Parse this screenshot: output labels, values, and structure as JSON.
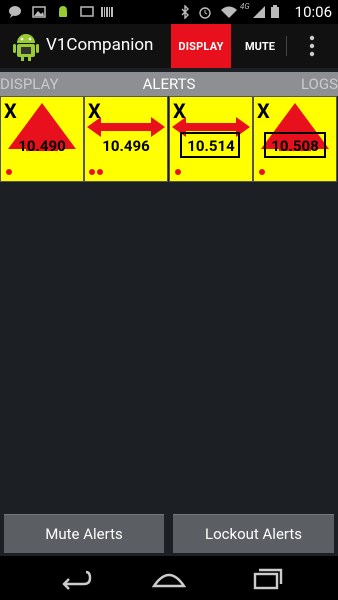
{
  "status_bar": {
    "time": "10:06",
    "icons": [
      "chat-bubble-icon",
      "image-icon",
      "android-icon",
      "cast-icon",
      "barcode-icon",
      "bluetooth-icon",
      "alarm-icon",
      "wifi-icon",
      "signal-icon",
      "battery-icon"
    ],
    "network_label": "4G"
  },
  "action_bar": {
    "title": "V1Companion",
    "display_label": "DISPLAY",
    "mute_label": "MUTE"
  },
  "tabs": {
    "left": "DISPLAY",
    "center": "ALERTS",
    "right": "LOGS"
  },
  "alerts": [
    {
      "band": "X",
      "frequency": "10.490",
      "arrow": "front",
      "signal_dots": 1,
      "boxed": false
    },
    {
      "band": "X",
      "frequency": "10.496",
      "arrow": "side",
      "signal_dots": 2,
      "boxed": false
    },
    {
      "band": "X",
      "frequency": "10.514",
      "arrow": "side",
      "signal_dots": 1,
      "boxed": true
    },
    {
      "band": "X",
      "frequency": "10.508",
      "arrow": "front",
      "signal_dots": 1,
      "boxed": true
    }
  ],
  "buttons": {
    "mute_alerts": "Mute Alerts",
    "lockout_alerts": "Lockout Alerts"
  },
  "colors": {
    "accent_red": "#e8101c",
    "card_yellow": "#ffff00",
    "background": "#1c1f23",
    "tab_strip": "#8d8f92"
  }
}
